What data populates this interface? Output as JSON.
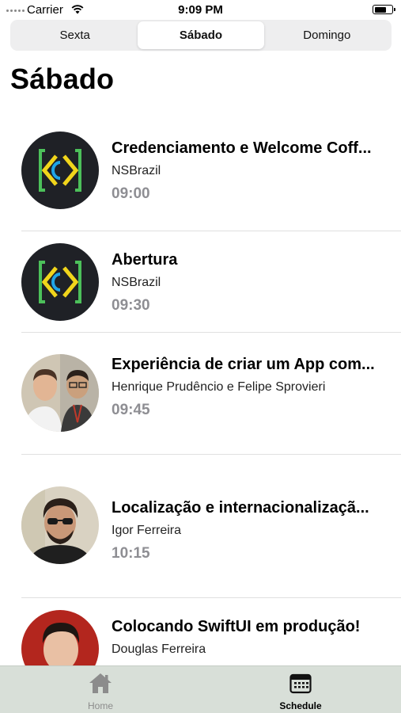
{
  "status_bar": {
    "carrier": "Carrier",
    "time": "9:09 PM",
    "battery_level": 0.75
  },
  "segmented_control": {
    "segments": [
      "Sexta",
      "Sábado",
      "Domingo"
    ],
    "selected": "Sábado"
  },
  "page_title": "Sábado",
  "sessions": [
    {
      "title": "Credenciamento e Welcome Coff...",
      "speaker": "NSBrazil",
      "time": "09:00",
      "avatar": "nsbrazil-logo"
    },
    {
      "title": "Abertura",
      "speaker": "NSBrazil",
      "time": "09:30",
      "avatar": "nsbrazil-logo"
    },
    {
      "title": "Experiência de criar um App com...",
      "speaker": "Henrique Prudêncio e Felipe Sprovieri",
      "time": "09:45",
      "avatar": "two-speakers-photo"
    },
    {
      "title": "Localização e internacionalizaçã...",
      "speaker": "Igor Ferreira",
      "time": "10:15",
      "avatar": "speaker-photo"
    },
    {
      "title": "Colocando SwiftUI em produção!",
      "speaker": "Douglas Ferreira",
      "time": "",
      "avatar": "speaker-photo"
    }
  ],
  "tab_bar": {
    "tabs": [
      {
        "label": "Home",
        "icon": "house-icon",
        "selected": false
      },
      {
        "label": "Schedule",
        "icon": "calendar-icon",
        "selected": true
      }
    ]
  },
  "colors": {
    "tab_bar_bg": "#d8dfd8",
    "segment_bg": "#eeeeef",
    "time_gray": "#8e8e93",
    "logo_bg": "#1f2126",
    "logo_green": "#4cc05a",
    "logo_yellow": "#f1d51b",
    "logo_blue": "#1fa5e8"
  }
}
